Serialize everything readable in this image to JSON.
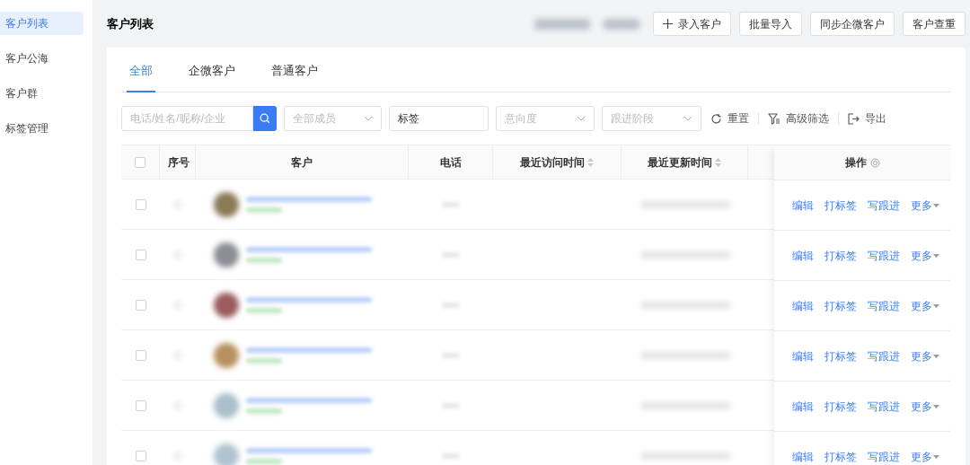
{
  "sidebar": {
    "items": [
      {
        "label": "客户列表",
        "selected": true
      },
      {
        "label": "客户公海",
        "selected": false
      },
      {
        "label": "客户群",
        "selected": false
      },
      {
        "label": "标签管理",
        "selected": false
      }
    ]
  },
  "header": {
    "title": "客户列表",
    "buttons": [
      {
        "label": "录入客户",
        "kind": "add"
      },
      {
        "label": "批量导入",
        "kind": "plain"
      },
      {
        "label": "同步企微客户",
        "kind": "plain"
      },
      {
        "label": "客户查重",
        "kind": "plain"
      }
    ]
  },
  "tabs": [
    {
      "label": "全部",
      "selected": true
    },
    {
      "label": "企微客户",
      "selected": false
    },
    {
      "label": "普通客户",
      "selected": false
    }
  ],
  "filters": {
    "search": {
      "placeholder": "电话/姓名/昵称/企业"
    },
    "member": {
      "placeholder": "全部成员"
    },
    "tag": {
      "value": "标签"
    },
    "intent": {
      "placeholder": "意向度"
    },
    "stage": {
      "placeholder": "跟进阶段"
    },
    "actions": [
      {
        "label": "重置",
        "kind": "reset"
      },
      {
        "label": "高级筛选",
        "kind": "filter"
      },
      {
        "label": "导出",
        "kind": "export"
      }
    ]
  },
  "table": {
    "all_checked": false,
    "columns": [
      {
        "label": "序号",
        "sortable": false
      },
      {
        "label": "客户",
        "sortable": false
      },
      {
        "label": "电话",
        "sortable": false
      },
      {
        "label": "最近访问时间",
        "sortable": true
      },
      {
        "label": "最近更新时间",
        "sortable": true
      }
    ],
    "actions_column": {
      "label": "操作"
    },
    "rows": [
      {
        "checked": false,
        "actions": [
          "编辑",
          "打标签",
          "写跟进",
          "更多"
        ]
      },
      {
        "checked": false,
        "actions": [
          "编辑",
          "打标签",
          "写跟进",
          "更多"
        ]
      },
      {
        "checked": false,
        "actions": [
          "编辑",
          "打标签",
          "写跟进",
          "更多"
        ]
      },
      {
        "checked": false,
        "actions": [
          "编辑",
          "打标签",
          "写跟进",
          "更多"
        ]
      },
      {
        "checked": false,
        "actions": [
          "编辑",
          "打标签",
          "写跟进",
          "更多"
        ]
      },
      {
        "checked": false,
        "actions": [
          "编辑",
          "打标签",
          "写跟进",
          "更多"
        ]
      }
    ]
  }
}
